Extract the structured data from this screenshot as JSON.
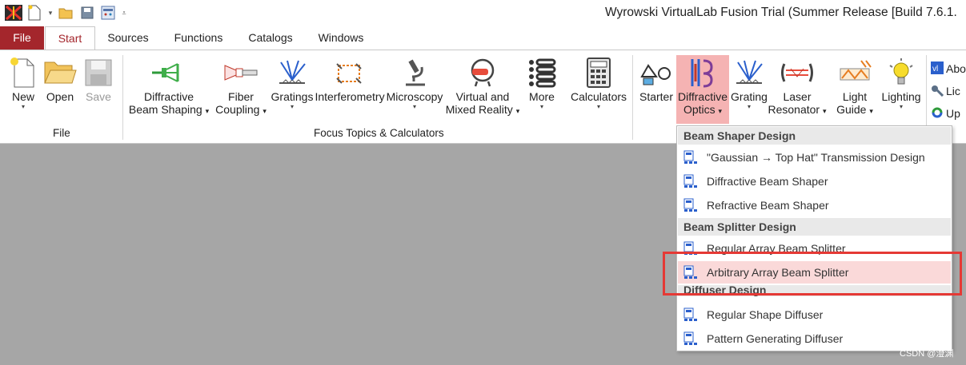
{
  "window": {
    "title": "Wyrowski VirtualLab Fusion Trial (Summer Release [Build 7.6.1."
  },
  "tabs": [
    {
      "label": "File"
    },
    {
      "label": "Start"
    },
    {
      "label": "Sources"
    },
    {
      "label": "Functions"
    },
    {
      "label": "Catalogs"
    },
    {
      "label": "Windows"
    }
  ],
  "ribbon": {
    "file_group": {
      "label": "File",
      "new": "New",
      "open": "Open",
      "save": "Save"
    },
    "focus_group": {
      "label": "Focus Topics & Calculators",
      "diffractive_beam_shaping": [
        "Diffractive",
        "Beam Shaping"
      ],
      "fiber_coupling": [
        "Fiber",
        "Coupling"
      ],
      "gratings": "Gratings",
      "interferometry": "Interferometry",
      "microscopy": "Microscopy",
      "virtual_mixed_reality": [
        "Virtual and",
        "Mixed Reality"
      ],
      "more": "More",
      "calculators": "Calculators"
    },
    "starter_group": {
      "starter": "Starter",
      "diffractive_optics": [
        "Diffractive",
        "Optics"
      ],
      "grating": "Grating",
      "laser_resonator": [
        "Laser",
        "Resonator"
      ],
      "light_guide": [
        "Light",
        "Guide"
      ],
      "lighting": "Lighting"
    },
    "help_group": {
      "about": "Abo",
      "license": "Lic",
      "update": "Up"
    }
  },
  "dropdown": {
    "sections": [
      {
        "header": "Beam Shaper Design",
        "items": [
          "\"Gaussian → Top Hat\" Transmission Design",
          "Diffractive Beam Shaper",
          "Refractive Beam Shaper"
        ]
      },
      {
        "header": "Beam Splitter Design",
        "items": [
          "Regular Array Beam Splitter",
          "Arbitrary Array Beam Splitter"
        ]
      },
      {
        "header": "Diffuser Design",
        "items": [
          "Regular Shape Diffuser",
          "Pattern Generating Diffuser"
        ]
      }
    ],
    "selected_item": "Arbitrary Array Beam Splitter"
  },
  "watermark": "CSDN @澄渊",
  "colors": {
    "file_tab": "#a4262c",
    "highlight": "#f5b3b3",
    "selection": "#fad9d9",
    "annotation": "#e53935"
  }
}
